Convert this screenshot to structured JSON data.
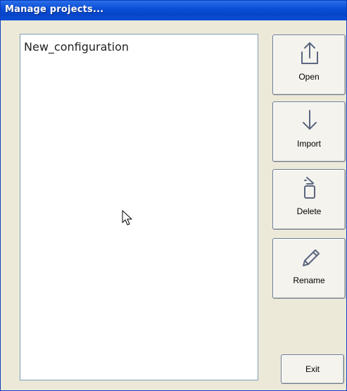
{
  "window": {
    "title": "Manage projects..."
  },
  "projects": {
    "items": [
      "New_configuration"
    ]
  },
  "actions": {
    "open_label": "Open",
    "import_label": "Import",
    "delete_label": "Delete",
    "rename_label": "Rename",
    "exit_label": "Exit"
  },
  "icons": {
    "open": "upload-icon",
    "import": "download-arrow-icon",
    "delete": "trash-icon",
    "rename": "pencil-icon",
    "pointer": "mouse-pointer-icon"
  },
  "colors": {
    "titlebar": "#0a4fd6",
    "dialog_background": "#ece9d8",
    "icon_stroke": "#5b6680"
  }
}
